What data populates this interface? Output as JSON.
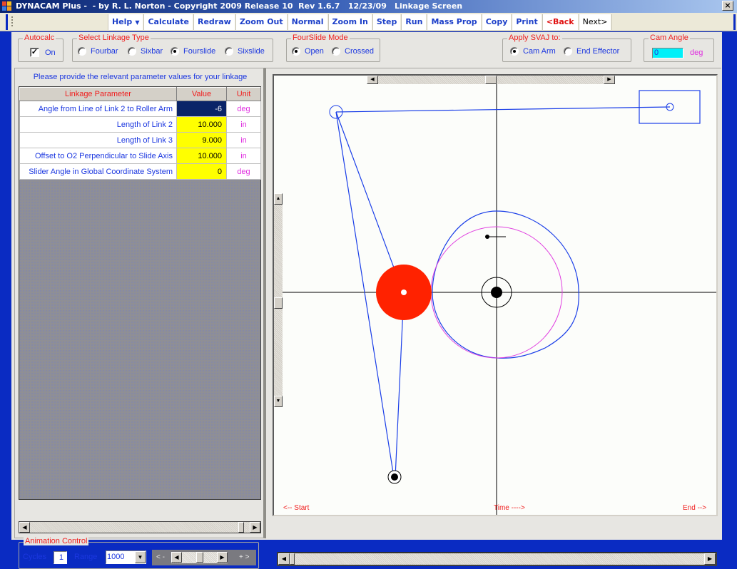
{
  "window": {
    "title": "DYNACAM Plus -  - by R. L. Norton - Copyright 2009 Release 10  Rev 1.6.7   12/23/09",
    "screen_name": "Linkage Screen",
    "close_glyph": "×"
  },
  "toolbar": {
    "items": [
      {
        "label": "Help",
        "has_dropdown": true,
        "caret": "▼"
      },
      {
        "label": "Calculate"
      },
      {
        "label": "Redraw"
      },
      {
        "label": "Zoom Out"
      },
      {
        "label": "Normal"
      },
      {
        "label": "Zoom In"
      },
      {
        "label": "Step"
      },
      {
        "label": "Run"
      },
      {
        "label": "Mass Prop"
      },
      {
        "label": "Copy"
      },
      {
        "label": "Print"
      },
      {
        "label": "<Back"
      },
      {
        "label": "Next>"
      }
    ]
  },
  "autocalc": {
    "title": "Autocalc",
    "label": "On",
    "checked": true,
    "check_glyph": "✓"
  },
  "linkage_type": {
    "title": "Select Linkage Type",
    "options": [
      "Fourbar",
      "Sixbar",
      "Fourslide",
      "Sixslide"
    ],
    "selected": "Fourslide"
  },
  "fourslide_mode": {
    "title": "FourSlide Mode",
    "options": [
      "Open",
      "Crossed"
    ],
    "selected": "Open"
  },
  "apply_svaj": {
    "title": "Apply SVAJ to:",
    "options": [
      "Cam Arm",
      "End Effector"
    ],
    "selected": "Cam Arm"
  },
  "cam_angle": {
    "title": "Cam Angle",
    "value": "0",
    "unit": "deg"
  },
  "parameters": {
    "instruction": "Please provide the relevant parameter values for your linkage",
    "headers": [
      "Linkage Parameter",
      "Value",
      "Unit"
    ],
    "rows": [
      {
        "param": "Angle from Line of Link 2 to Roller Arm",
        "value": "-6",
        "unit": "deg",
        "selected": true
      },
      {
        "param": "Length of Link 2",
        "value": "10.000",
        "unit": "in"
      },
      {
        "param": "Length of Link 3",
        "value": "9.000",
        "unit": "in"
      },
      {
        "param": "Offset to O2 Perpendicular to Slide Axis",
        "value": "10.000",
        "unit": "in"
      },
      {
        "param": "Slider Angle in Global Coordinate System",
        "value": "0",
        "unit": "deg"
      }
    ]
  },
  "animation": {
    "title": "Animation Control",
    "cycles_label": "Cycles",
    "cycles_value": "1",
    "range_label": "Range",
    "range_value": "1000",
    "slower_label": "< -",
    "faster_label": "+ >",
    "speed_fraction": 0.5
  },
  "plot": {
    "start_label": "<-- Start",
    "time_label": "Time ---->",
    "end_label": "End -->",
    "time_position_fraction": 0.0,
    "colors": {
      "link": "#1a3ee8",
      "roller": "#ff2200",
      "pitch_curve": "#e040e0",
      "axes": "#000000",
      "background": "#fcfdfa"
    }
  },
  "scroll_glyphs": {
    "left": "◀",
    "right": "▶",
    "up": "▲",
    "down": "▼"
  }
}
